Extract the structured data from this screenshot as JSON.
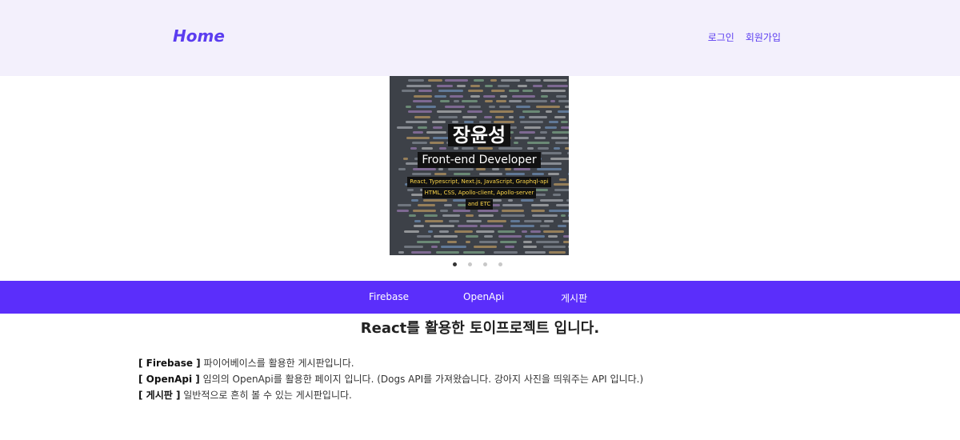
{
  "header": {
    "logo": "Home",
    "links": [
      "로그인",
      "회원가입"
    ]
  },
  "banner": {
    "name": "장윤성",
    "role": "Front-end Developer",
    "stack": [
      "React, Typescript, Next.js, JavaScript, Graphql-api",
      "HTML, CSS, Apollo-client, Apollo-server",
      "and ETC"
    ]
  },
  "carousel": {
    "slides": 4,
    "active_index": 0
  },
  "nav": {
    "items": [
      "Firebase",
      "OpenApi",
      "게시판"
    ]
  },
  "intro": {
    "title": "React를 활용한 토이프로젝트 입니다.",
    "items": [
      {
        "label": "[ Firebase ]",
        "text": " 파이어베이스를 활용한 게시판입니다."
      },
      {
        "label": "[ OpenApi ]",
        "text": " 임의의 OpenApi를 활용한 페이지 입니다. (Dogs API를 가져왔습니다. 강아지 사진을 띄워주는 API 입니다.)"
      },
      {
        "label": "[ 게시판 ]",
        "text": " 일반적으로 흔히 볼 수 있는 게시판입니다."
      }
    ]
  },
  "colors": {
    "accent": "#5b2efb",
    "header_bg": "#f3f0fc",
    "logo": "#5b3df0"
  }
}
